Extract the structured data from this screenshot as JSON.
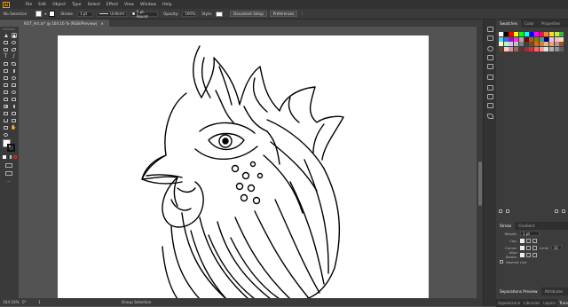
{
  "app": {
    "logo": "Ai"
  },
  "menu": [
    "File",
    "Edit",
    "Object",
    "Type",
    "Select",
    "Effect",
    "View",
    "Window",
    "Help"
  ],
  "control_bar": {
    "selection_label": "No Selection",
    "stroke_label": "Stroke:",
    "stroke_value": "1 pt",
    "stroke_profile": "Uniform",
    "brush": "5 pt. Round",
    "opacity_label": "Opacity:",
    "opacity_value": "100%",
    "style_label": "Style:",
    "document_setup": "Document Setup",
    "preferences": "Preferences"
  },
  "document_tab": {
    "title": "ROT_Art.ai* @ 104.16 % (RGB/Preview)",
    "close": "×"
  },
  "status_bar": {
    "zoom": "104.16%",
    "rotation": "0°",
    "artboard": "1",
    "tool": "Group Selection"
  },
  "right_panel": {
    "tabs": [
      "Swatches",
      "Color",
      "Properties"
    ],
    "stroke_tabs": [
      "Stroke",
      "Gradient"
    ],
    "stroke": {
      "weight_label": "Weight:",
      "weight_value": "1 pt",
      "cap_label": "Cap:",
      "corner_label": "Corner:",
      "limit_label": "Limit:",
      "limit_value": "10",
      "align_label": "Align Stroke:",
      "dashed_label": "Dashed Line"
    },
    "bottom_tabs_1": [
      "Separations Preview",
      "Attributes"
    ],
    "bottom_tabs_2": [
      "Appearance",
      "Libraries",
      "Layers",
      "Transparency"
    ]
  },
  "colors": {
    "app_bg": "#323232",
    "panel_bg": "#3c3c3c",
    "canvas_bg": "#535353",
    "artboard": "#ffffff",
    "accent": "#ff9a00"
  },
  "swatch_colors": [
    "#ffffff",
    "#000000",
    "#ff0000",
    "#ffff00",
    "#00ff00",
    "#00ffff",
    "#0000ff",
    "#ff00ff",
    "#e6194b",
    "#f58231",
    "#ffe119",
    "#bfef45",
    "#3cb44b",
    "#42d4f4",
    "#4363d8",
    "#911eb4",
    "#f032e6",
    "#a9a9a9",
    "#800000",
    "#9a6324",
    "#808000",
    "#469990",
    "#000075",
    "#e6beff",
    "#fabebe",
    "#ffd8b1",
    "#fffac8",
    "#aaffc3",
    "#dcbeff",
    "#c0c0c0",
    "#7f7f7f",
    "#404040",
    "#8b4513",
    "#d2691e",
    "#cd853f",
    "#deb887",
    "#f4a460",
    "#bc8f8f",
    "#a0522d",
    "#654321",
    "#ffcccc",
    "#cc9999",
    "#996666",
    "#663333",
    "#993333",
    "#cc3333",
    "#ff6666",
    "#ff9999",
    "#e0e0e0",
    "#b0b0b0",
    "#909090",
    "#606060"
  ]
}
